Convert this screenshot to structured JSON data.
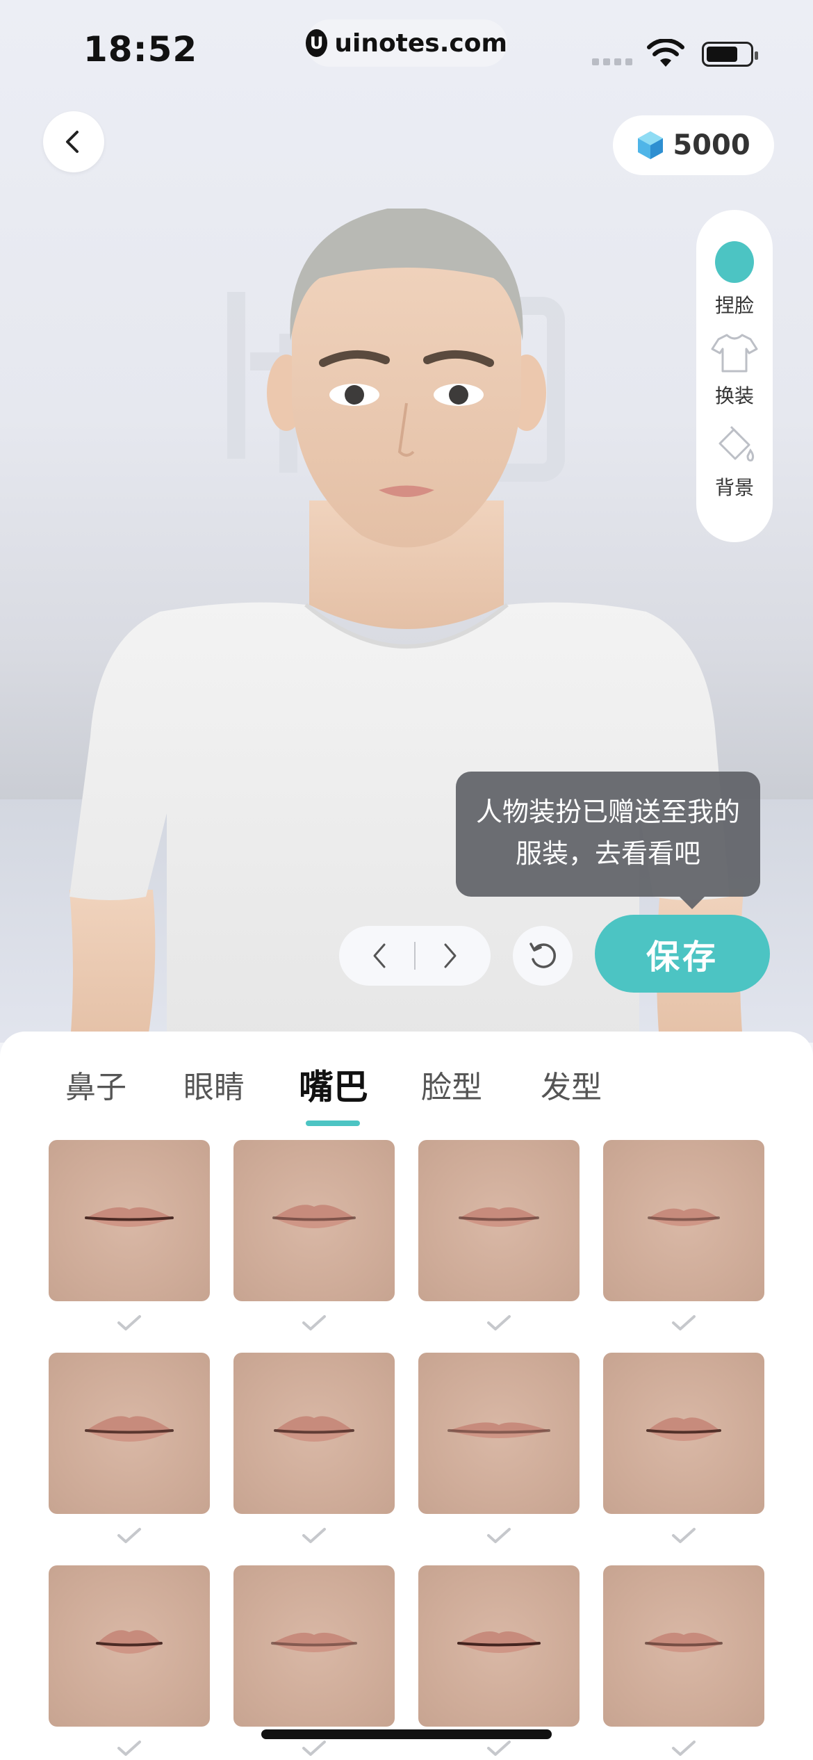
{
  "status_bar": {
    "time": "18:52",
    "url": "uinotes.com",
    "url_logo": "U"
  },
  "header": {
    "gem_count": "5000"
  },
  "side_menu": {
    "items": [
      {
        "label": "捏脸",
        "icon": "face-icon"
      },
      {
        "label": "换装",
        "icon": "shirt-icon"
      },
      {
        "label": "背景",
        "icon": "paint-bucket-icon"
      }
    ]
  },
  "tooltip": {
    "line1": "人物装扮已赠送至我的",
    "line2": "服装，去看看吧"
  },
  "actions": {
    "save_label": "保存"
  },
  "tabs": [
    {
      "label": "鼻子"
    },
    {
      "label": "眼睛"
    },
    {
      "label": "嘴巴"
    },
    {
      "label": "脸型"
    },
    {
      "label": "发型"
    }
  ],
  "active_tab": "嘴巴",
  "colors": {
    "accent": "#4cc4c3",
    "tooltip_bg": "#5f6267",
    "skin": "#d4b19f"
  }
}
